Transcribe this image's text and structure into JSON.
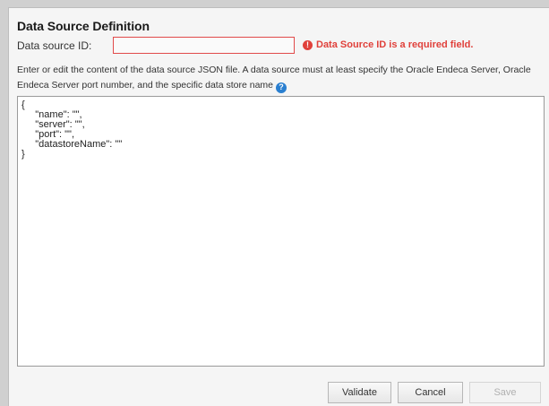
{
  "dialog": {
    "title": "Data Source Definition",
    "id_label": "Data source ID:",
    "id_value": "",
    "error_icon": "!",
    "error_message": "Data Source ID is a required field.",
    "help_text": "Enter or edit the content of the data source JSON file. A data source must at least specify the Oracle Endeca Server, Oracle Endeca Server port number, and the specific data store name",
    "help_icon": "?",
    "json_content": "{\n     \"name\": \"\",\n     \"server\": \"\",\n     \"port\": \"\",\n     \"datastoreName\": \"\"\n}",
    "buttons": {
      "validate": "Validate",
      "cancel": "Cancel",
      "save": "Save"
    }
  },
  "colors": {
    "error": "#e0413b",
    "help_icon": "#2a7fd0",
    "input_border_error": "#e14a4a"
  }
}
